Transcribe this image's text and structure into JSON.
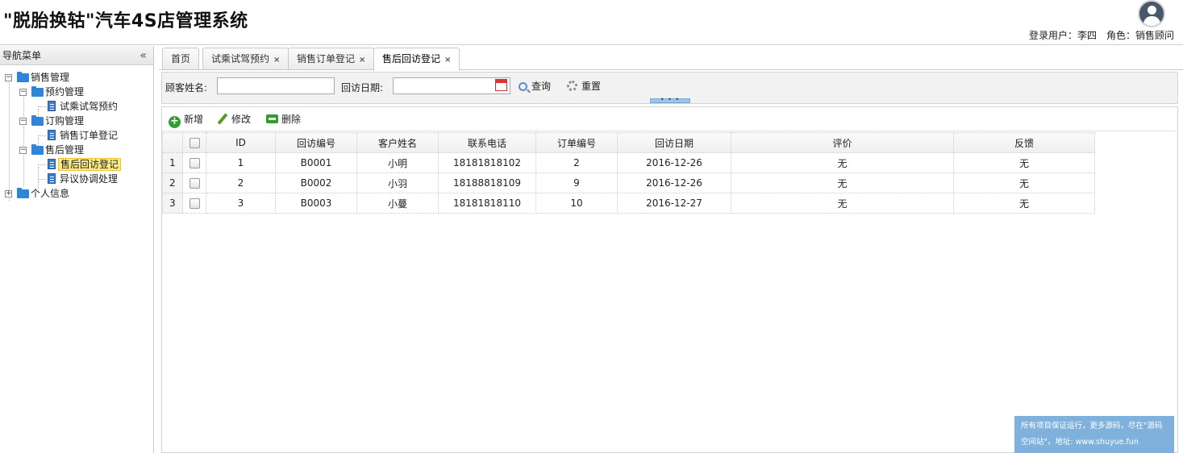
{
  "header": {
    "title": "\"脱胎换轱\"汽车4S店管理系统",
    "user_info": "登录用户：李四　角色：销售顾问"
  },
  "sidebar": {
    "title": "导航菜单",
    "collapse_icon": "«",
    "tree": {
      "sales": "销售管理",
      "reservation": "预约管理",
      "test_drive": "试乘试驾预约",
      "order": "订购管理",
      "order_register": "销售订单登记",
      "aftersales": "售后管理",
      "followup_register": "售后回访登记",
      "dispute": "异议协调处理",
      "personal": "个人信息"
    }
  },
  "tabs": [
    {
      "label": "首页"
    },
    {
      "label": "试乘试驾预约"
    },
    {
      "label": "销售订单登记"
    },
    {
      "label": "售后回访登记"
    }
  ],
  "search": {
    "customer_label": "顾客姓名:",
    "customer_value": "",
    "date_label": "回访日期:",
    "date_value": "",
    "query_label": "查询",
    "reset_label": "重置"
  },
  "toolbar": {
    "add_label": "新增",
    "edit_label": "修改",
    "delete_label": "删除"
  },
  "table": {
    "columns": [
      "ID",
      "回访编号",
      "客户姓名",
      "联系电话",
      "订单编号",
      "回访日期",
      "评价",
      "反馈"
    ],
    "rows": [
      {
        "rownum": "1",
        "id": "1",
        "visit_no": "B0001",
        "name": "小明",
        "phone": "18181818102",
        "order_no": "2",
        "date": "2016-12-26",
        "rating": "无",
        "feedback": "无"
      },
      {
        "rownum": "2",
        "id": "2",
        "visit_no": "B0002",
        "name": "小羽",
        "phone": "18188818109",
        "order_no": "9",
        "date": "2016-12-26",
        "rating": "无",
        "feedback": "无"
      },
      {
        "rownum": "3",
        "id": "3",
        "visit_no": "B0003",
        "name": "小蔓",
        "phone": "18181818110",
        "order_no": "10",
        "date": "2016-12-27",
        "rating": "无",
        "feedback": "无"
      }
    ]
  },
  "footer_note": {
    "line1": "所有项目保证运行，更多源码，尽在\"源码",
    "line2": "空间站\"，地址: www.shuyue.fun"
  },
  "colors": {
    "accent": "#2f86d8",
    "selected_bg": "#fbec88",
    "note_bg": "#7fb1dc"
  }
}
